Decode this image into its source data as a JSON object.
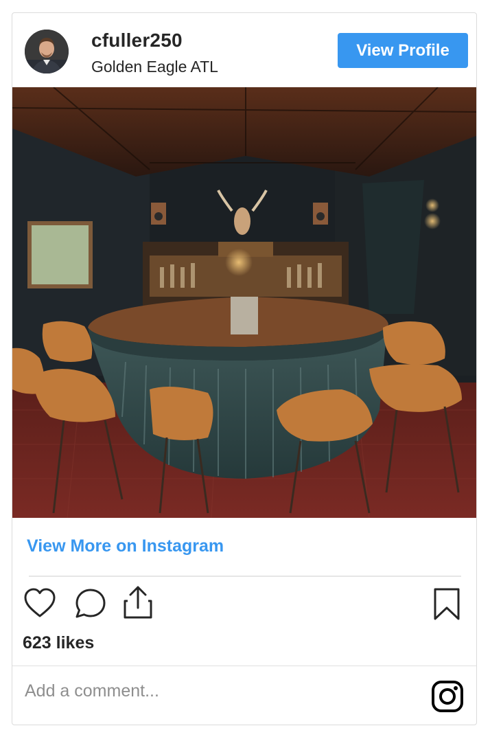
{
  "post": {
    "username": "cfuller250",
    "location": "Golden Eagle ATL",
    "view_profile_label": "View Profile",
    "view_more_label": "View More on Instagram",
    "likes_text": "623 likes",
    "comment_placeholder": "Add a comment..."
  },
  "colors": {
    "accent": "#3897f0",
    "text": "#262626",
    "muted": "#8e8e8e",
    "border": "#dbdbdb"
  },
  "icons": {
    "like": "heart-icon",
    "comment": "comment-bubble-icon",
    "share": "share-icon",
    "save": "bookmark-icon",
    "brand": "instagram-logo-icon"
  }
}
